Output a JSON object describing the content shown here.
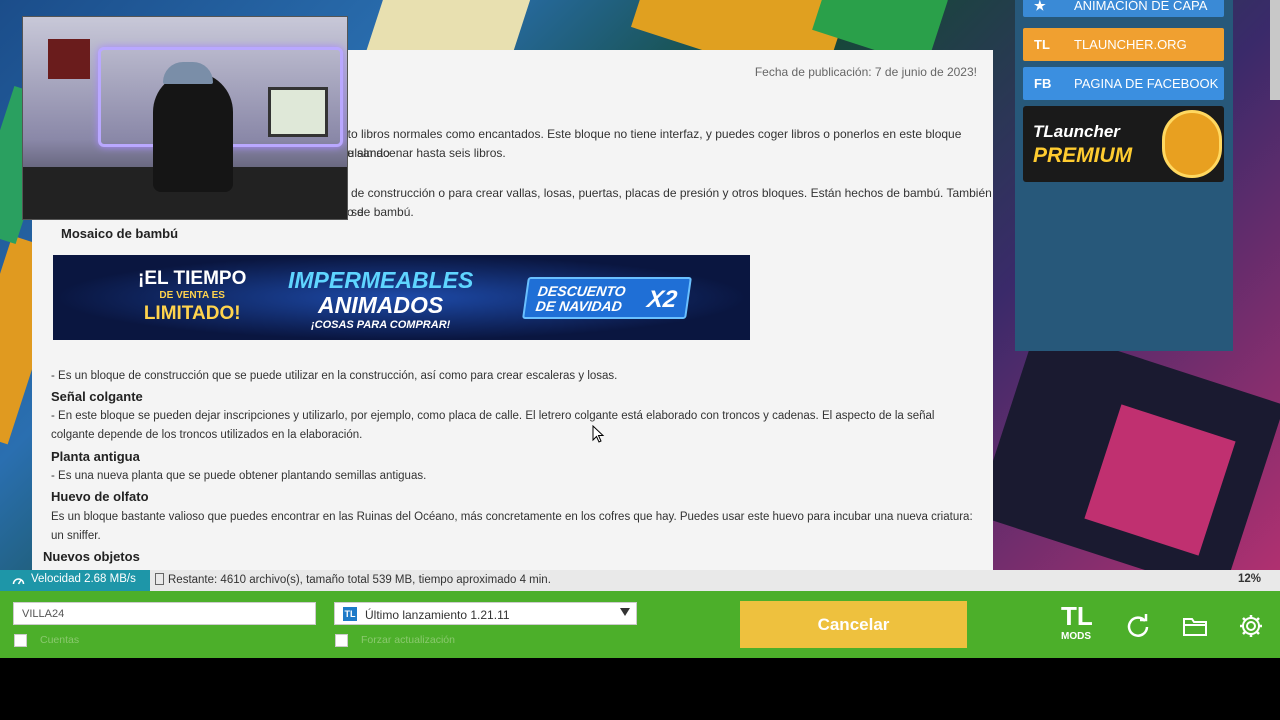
{
  "article": {
    "pub_date": "Fecha de publicación: 7 de junio de 2023!",
    "frag1a": "nto libros normales como encantados. Este bloque no tiene interfaz, y puedes coger libros o ponerlos en este bloque pulsando",
    "frag1b": "e almacenar hasta seis libros.",
    "frag2a": "de construcción o para crear vallas, losas, puertas, placas de presión y otros bloques. Están hechos de bambú. También se",
    "frag2b": "o de bambú.",
    "h_mosaico": "Mosaico de bambú",
    "p_mosaico": "- Es un bloque de construcción que se puede utilizar en la construcción, así como para crear escaleras y losas.",
    "h_senal": "Señal colgante",
    "p_senal": "- En este bloque se pueden dejar inscripciones y utilizarlo, por ejemplo, como placa de calle. El letrero colgante está elaborado con troncos y cadenas. El aspecto de la señal colgante depende de los troncos utilizados en la elaboración.",
    "h_planta": "Planta antigua",
    "p_planta": "- Es una nueva planta que se puede obtener plantando semillas antiguas.",
    "h_huevo": "Huevo de olfato",
    "p_huevo": "Es un bloque bastante valioso que puedes encontrar en las Ruinas del Océano, más concretamente en los cofres que hay. Puedes usar este huevo para incubar una nueva criatura: un sniffer.",
    "h_nuevos": "Nuevos objetos"
  },
  "promo": {
    "left_a": "¡EL TIEMPO",
    "left_b": "DE VENTA ES",
    "left_c": "LIMITADO!",
    "mid_a": "IMPERMEABLES",
    "mid_b": "ANIMADOS",
    "mid_c": "¡COSAS PARA COMPRAR!",
    "badge": "DESCUENTO DE NAVIDAD",
    "badge_x2": "X2"
  },
  "sidebar": {
    "cape_label": "ANIMACIÓN DE CAPA",
    "tl_prefix": "TL",
    "tl_label": "TLAUNCHER.ORG",
    "fb_prefix": "FB",
    "fb_label": "PAGINA DE FACEBOOK",
    "premium_1": "TLauncher",
    "premium_2": "PREMIUM"
  },
  "status": {
    "speed": "Velocidad 2.68 MB/s",
    "remaining": "Restante: 4610 archivo(s), tamaño total 539 MB, tiempo aproximado 4 min.",
    "percent": "12%"
  },
  "bottom": {
    "username": "VILLA24",
    "accounts_label": "Cuentas",
    "version_icon": "TL",
    "version": "Último lanzamiento 1.21.11",
    "force_update_label": "Forzar actualización",
    "cancel": "Cancelar",
    "logo_top": "TL",
    "logo_bottom": "MODS"
  },
  "colors": {
    "bottom_bar": "#4caf2a",
    "cancel_button": "#eec13e",
    "speed_badge": "#1e96a8",
    "tl_button": "#f0a030",
    "fb_button": "#3b8fe0"
  }
}
